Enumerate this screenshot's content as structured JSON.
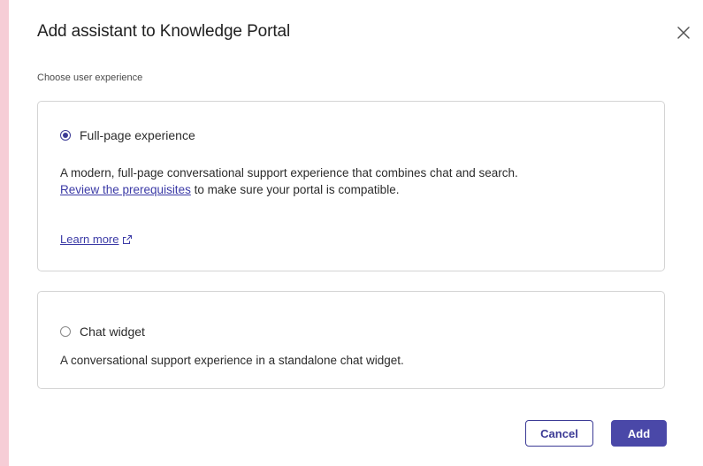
{
  "dialog": {
    "title": "Add assistant to Knowledge Portal",
    "subtitle": "Choose user experience",
    "close_icon": "close-icon"
  },
  "options": [
    {
      "label": "Full-page experience",
      "selected": true,
      "desc_before": "A modern, full-page conversational support experience that combines chat and search.",
      "desc_link": "Review the prerequisites",
      "desc_after": "to make sure your portal is compatible.",
      "learn_more": "Learn more",
      "learn_more_icon": "external-link-icon"
    },
    {
      "label": "Chat widget",
      "selected": false,
      "desc": "A conversational support experience in a standalone chat widget."
    }
  ],
  "footer": {
    "cancel_label": "Cancel",
    "add_label": "Add"
  },
  "colors": {
    "accent": "#3b3a95",
    "primary_button": "#4a48a8",
    "link": "#3b3aa6",
    "background_strip": "#f6cdd6"
  }
}
